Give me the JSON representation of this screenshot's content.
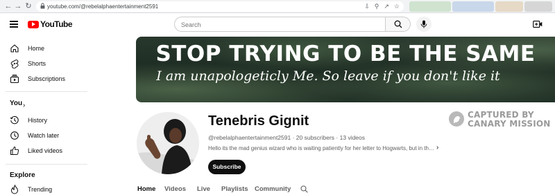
{
  "browser": {
    "url": "youtube.com/@rebelalphaentertainment2591"
  },
  "masthead": {
    "logo_text": "YouTube",
    "search_placeholder": "Search"
  },
  "sidebar": {
    "main_items": [
      {
        "label": "Home",
        "icon": "home-icon"
      },
      {
        "label": "Shorts",
        "icon": "shorts-icon"
      },
      {
        "label": "Subscriptions",
        "icon": "subscriptions-icon"
      }
    ],
    "you_heading": "You",
    "you_items": [
      {
        "label": "History",
        "icon": "history-icon"
      },
      {
        "label": "Watch later",
        "icon": "watch-later-icon"
      },
      {
        "label": "Liked videos",
        "icon": "liked-videos-icon"
      }
    ],
    "explore_heading": "Explore",
    "explore_items": [
      {
        "label": "Trending",
        "icon": "trending-icon"
      }
    ]
  },
  "banner": {
    "headline": "STOP TRYING TO BE THE SAME",
    "tagline": "I am unapologeticly Me. So leave if you don't like it"
  },
  "channel": {
    "name": "Tenebris Gignit",
    "handle": "@rebelalphaentertainment2591",
    "subscribers": "20 subscribers",
    "videos": "13 videos",
    "separator": " · ",
    "description": "Hello its the mad genius wizard who is waiting patiently for her letter to Hogwarts, but in the meantime",
    "subscribe_label": "Subscribe"
  },
  "tabs": [
    {
      "label": "Home",
      "active": true
    },
    {
      "label": "Videos",
      "active": false
    },
    {
      "label": "Live",
      "active": false
    },
    {
      "label": "Playlists",
      "active": false
    },
    {
      "label": "Community",
      "active": false
    }
  ],
  "watermark": {
    "line1": "CAPTURED BY",
    "line2": "CANARY MISSION"
  },
  "colors": {
    "brand_red": "#ff0000",
    "subscribe_bg": "#0f0f0f",
    "banner_dark": "#1c2a21"
  }
}
